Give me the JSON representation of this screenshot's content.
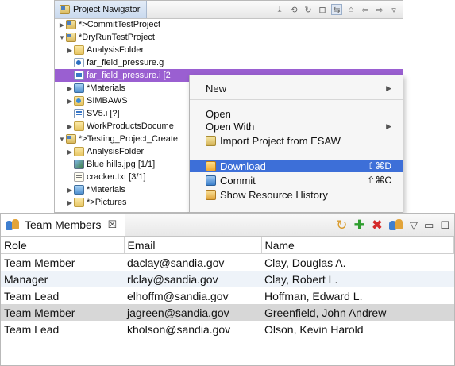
{
  "navigator": {
    "title": "Project Navigator",
    "tree": [
      {
        "label": "*>CommitTestProject",
        "twisty": "▶",
        "icon": "project-icon"
      },
      {
        "label": "*DryRunTestProject",
        "twisty": "▼",
        "icon": "project-icon"
      },
      {
        "label": "AnalysisFolder",
        "twisty": "▶",
        "icon": "folder-icon"
      },
      {
        "label": "far_field_pressure.g",
        "twisty": "",
        "icon": "geometry-file-icon"
      },
      {
        "label": "far_field_pressure.i [2",
        "twisty": "",
        "icon": "input-file-icon",
        "selected": true
      },
      {
        "label": "*Materials",
        "twisty": "▶",
        "icon": "materials-icon"
      },
      {
        "label": "SIMBAWS",
        "twisty": "▶",
        "icon": "web-folder-icon"
      },
      {
        "label": "SV5.i [?]",
        "twisty": "",
        "icon": "input-file-icon"
      },
      {
        "label": "WorkProductsDocume",
        "twisty": "▶",
        "icon": "folder-icon"
      },
      {
        "label": "*>Testing_Project_Create",
        "twisty": "▼",
        "icon": "project-icon"
      },
      {
        "label": "AnalysisFolder",
        "twisty": "▶",
        "icon": "folder-icon"
      },
      {
        "label": "Blue hills.jpg [1/1]",
        "twisty": "",
        "icon": "image-file-icon"
      },
      {
        "label": "cracker.txt [3/1]",
        "twisty": "",
        "icon": "text-file-icon"
      },
      {
        "label": "*Materials",
        "twisty": "▶",
        "icon": "materials-icon"
      },
      {
        "label": "*>Pictures",
        "twisty": "▶",
        "icon": "folder-icon"
      }
    ]
  },
  "context_menu": {
    "items": [
      {
        "label": "New",
        "arrow": "▶"
      },
      {
        "label": "Open"
      },
      {
        "label": "Open With",
        "arrow": "▶"
      },
      {
        "label": "Import Project from ESAW",
        "icon": "import-icon"
      },
      {
        "label": "Download",
        "shortcut": "⇧⌘D",
        "icon": "download-icon",
        "highlighted": true
      },
      {
        "label": "Commit",
        "shortcut": "⇧⌘C",
        "icon": "commit-icon"
      },
      {
        "label": "Show Resource History",
        "icon": "history-icon"
      }
    ]
  },
  "team": {
    "title": "Team Members",
    "close_glyph": "☒",
    "toolbar_icons": [
      "refresh-icon",
      "add-member-icon",
      "remove-member-icon",
      "team-icon",
      "view-menu-icon",
      "minimize-icon",
      "maximize-icon"
    ],
    "columns": [
      "Role",
      "Email",
      "Name"
    ],
    "rows": [
      {
        "role": "Team Member",
        "email": "daclay@sandia.gov",
        "name": "Clay, Douglas A."
      },
      {
        "role": "Manager",
        "email": "rlclay@sandia.gov",
        "name": "Clay, Robert L."
      },
      {
        "role": "Team Lead",
        "email": "elhoffm@sandia.gov",
        "name": "Hoffman, Edward L."
      },
      {
        "role": "Team Member",
        "email": "jagreen@sandia.gov",
        "name": "Greenfield, John Andrew",
        "selected": true
      },
      {
        "role": "Team Lead",
        "email": "kholson@sandia.gov",
        "name": "Olson, Kevin Harold"
      }
    ]
  },
  "colors": {
    "selection_purple": "#9a5fd1",
    "menu_highlight": "#3d6fd8",
    "row_selected": "#d7d7d7",
    "row_alt": "#eef3f9"
  }
}
